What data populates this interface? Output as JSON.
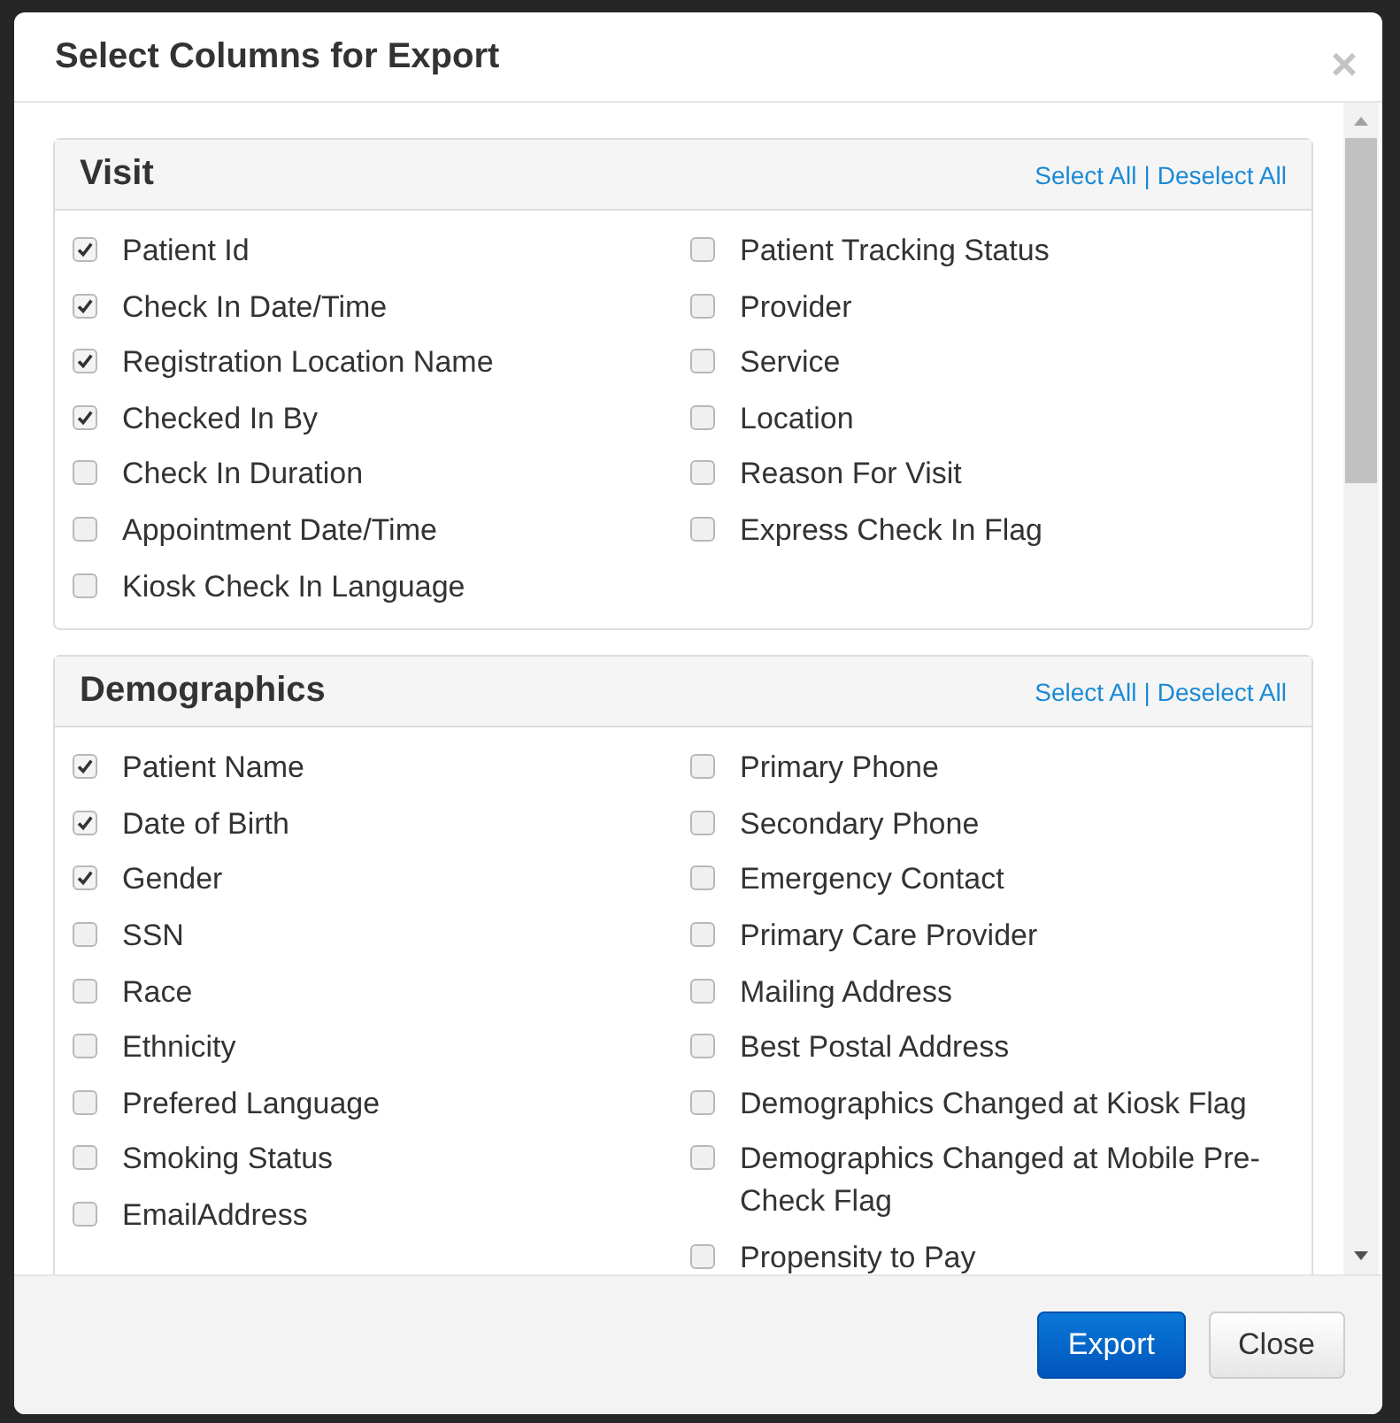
{
  "dialog": {
    "title": "Select Columns for Export",
    "close_symbol": "×"
  },
  "sections": [
    {
      "title": "Visit",
      "select_all": "Select All",
      "separator": "|",
      "deselect_all": "Deselect All",
      "left_column": [
        {
          "label": "Patient Id",
          "checked": true
        },
        {
          "label": "Check In Date/Time",
          "checked": true
        },
        {
          "label": "Registration Location Name",
          "checked": true
        },
        {
          "label": "Checked In By",
          "checked": true
        },
        {
          "label": "Check In Duration",
          "checked": false
        },
        {
          "label": "Appointment Date/Time",
          "checked": false
        },
        {
          "label": "Kiosk Check In Language",
          "checked": false
        }
      ],
      "right_column": [
        {
          "label": "Patient Tracking Status",
          "checked": false
        },
        {
          "label": "Provider",
          "checked": false
        },
        {
          "label": "Service",
          "checked": false
        },
        {
          "label": "Location",
          "checked": false
        },
        {
          "label": "Reason For Visit",
          "checked": false
        },
        {
          "label": "Express Check In Flag",
          "checked": false
        }
      ]
    },
    {
      "title": "Demographics",
      "select_all": "Select All",
      "separator": "|",
      "deselect_all": "Deselect All",
      "left_column": [
        {
          "label": "Patient Name",
          "checked": true
        },
        {
          "label": "Date of Birth",
          "checked": true
        },
        {
          "label": "Gender",
          "checked": true
        },
        {
          "label": "SSN",
          "checked": false
        },
        {
          "label": "Race",
          "checked": false
        },
        {
          "label": "Ethnicity",
          "checked": false
        },
        {
          "label": "Prefered Language",
          "checked": false
        },
        {
          "label": "Smoking Status",
          "checked": false
        },
        {
          "label": "EmailAddress",
          "checked": false
        }
      ],
      "right_column": [
        {
          "label": "Primary Phone",
          "checked": false
        },
        {
          "label": "Secondary Phone",
          "checked": false
        },
        {
          "label": "Emergency Contact",
          "checked": false
        },
        {
          "label": "Primary Care Provider",
          "checked": false
        },
        {
          "label": "Mailing Address",
          "checked": false
        },
        {
          "label": "Best Postal Address",
          "checked": false
        },
        {
          "label": "Demographics Changed at Kiosk Flag",
          "checked": false
        },
        {
          "label": "Demographics Changed at Mobile Pre-Check Flag",
          "checked": false
        },
        {
          "label": "Propensity to Pay",
          "checked": false
        }
      ]
    }
  ],
  "buttons": [
    {
      "label": "Export",
      "kind": "primary"
    },
    {
      "label": "Close",
      "kind": "default"
    }
  ]
}
